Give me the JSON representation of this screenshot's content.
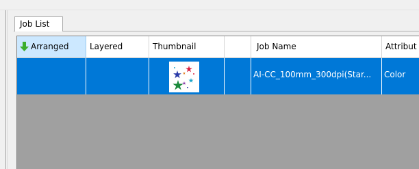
{
  "tab": {
    "label": "Job List"
  },
  "table": {
    "columns": [
      "Arranged",
      "Layered",
      "Thumbnail",
      "",
      "Job Name",
      "Attribut"
    ],
    "sort_column": "Arranged",
    "rows": [
      {
        "arranged": "",
        "layered": "",
        "thumbnail": "stars-thumbnail",
        "extra": "",
        "job_name": "AI-CC_100mm_300dpi(Star...",
        "attribute": "Color",
        "selected": true
      }
    ]
  },
  "colors": {
    "selection": "#0078d7",
    "empty_area": "#a0a0a0",
    "sort_header": "#cce8ff",
    "sort_arrow": "#3cae2d"
  }
}
